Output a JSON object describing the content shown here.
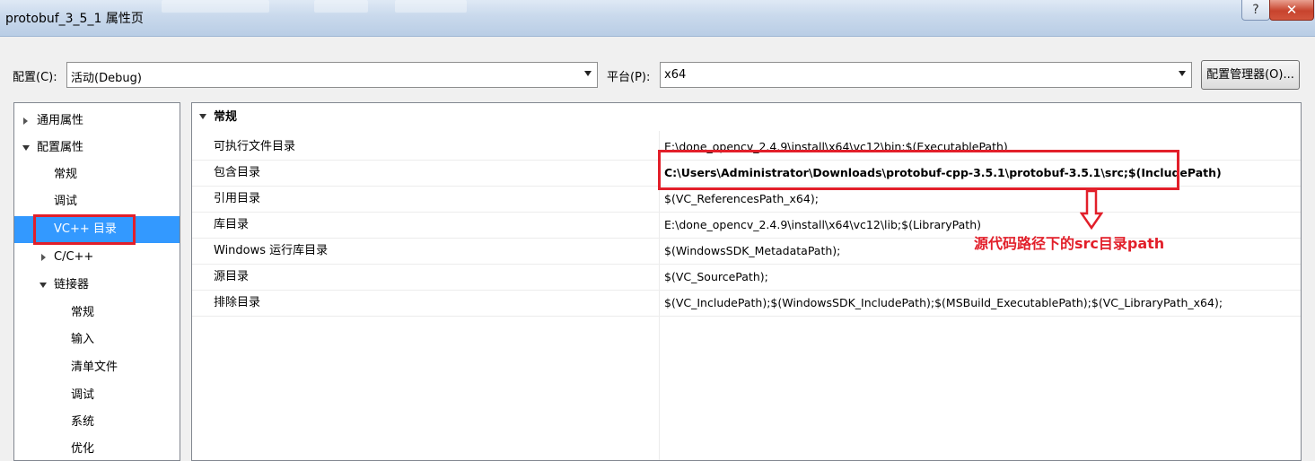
{
  "window": {
    "title": "protobuf_3_5_1 属性页",
    "help_glyph": "?",
    "close_glyph": "✕"
  },
  "config_bar": {
    "config_label": "配置(C):",
    "config_value": "活动(Debug)",
    "platform_label": "平台(P):",
    "platform_value": "x64",
    "manager_button": "配置管理器(O)..."
  },
  "tree": {
    "items": [
      {
        "label": "通用属性",
        "expander": "collapsed"
      },
      {
        "label": "配置属性",
        "expander": "expanded"
      },
      {
        "label": "常规",
        "expander": "none"
      },
      {
        "label": "调试",
        "expander": "none"
      },
      {
        "label": "VC++ 目录",
        "expander": "none",
        "selected": true
      },
      {
        "label": "C/C++",
        "expander": "collapsed"
      },
      {
        "label": "链接器",
        "expander": "expanded"
      },
      {
        "label": "常规",
        "expander": "none"
      },
      {
        "label": "输入",
        "expander": "none"
      },
      {
        "label": "清单文件",
        "expander": "none"
      },
      {
        "label": "调试",
        "expander": "none"
      },
      {
        "label": "系统",
        "expander": "none"
      },
      {
        "label": "优化",
        "expander": "none"
      }
    ]
  },
  "grid": {
    "category": "常规",
    "rows": [
      {
        "name": "可执行文件目录",
        "value": "E:\\done_opencv_2.4.9\\install\\x64\\vc12\\bin;$(ExecutablePath)"
      },
      {
        "name": "包含目录",
        "value": "C:\\Users\\Administrator\\Downloads\\protobuf-cpp-3.5.1\\protobuf-3.5.1\\src;$(IncludePath)"
      },
      {
        "name": "引用目录",
        "value": "$(VC_ReferencesPath_x64);"
      },
      {
        "name": "库目录",
        "value": "E:\\done_opencv_2.4.9\\install\\x64\\vc12\\lib;$(LibraryPath)"
      },
      {
        "name": "Windows 运行库目录",
        "value": "$(WindowsSDK_MetadataPath);"
      },
      {
        "name": "源目录",
        "value": "$(VC_SourcePath);"
      },
      {
        "name": "排除目录",
        "value": "$(VC_IncludePath);$(WindowsSDK_IncludePath);$(MSBuild_ExecutablePath);$(VC_LibraryPath_x64);"
      }
    ]
  },
  "annotation": {
    "text": "源代码路径下的src目录path",
    "color": "#e21f2a"
  },
  "colors": {
    "selection": "#3399ff",
    "highlight_red": "#e21f2a"
  }
}
